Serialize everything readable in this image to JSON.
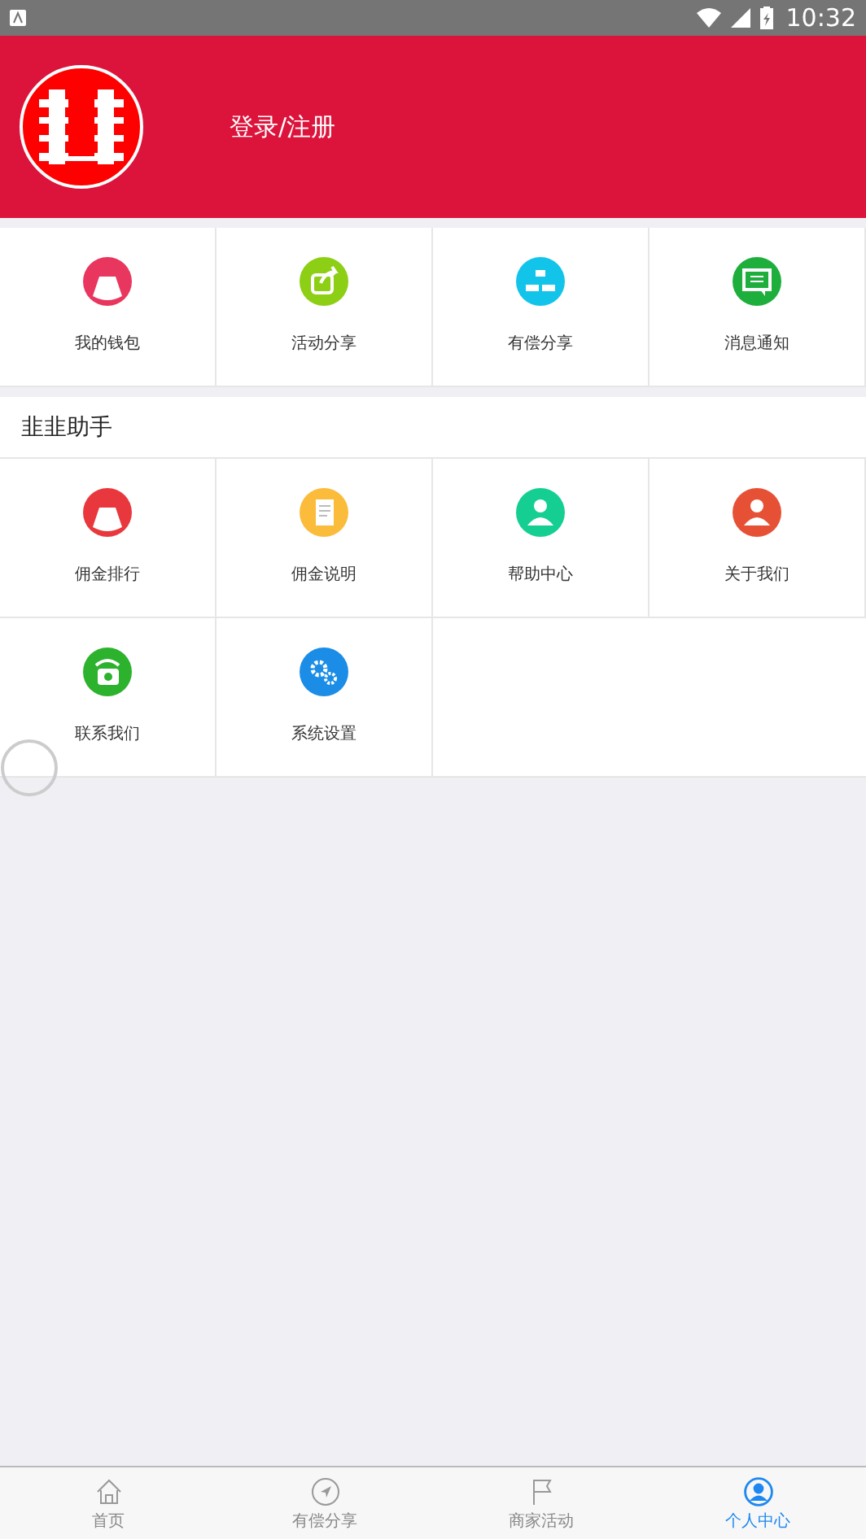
{
  "status_bar": {
    "time": "10:32"
  },
  "header": {
    "login_label": "登录/注册"
  },
  "quick_menu": [
    {
      "label": "我的钱包",
      "kind": "wallet",
      "color": "#e8365f"
    },
    {
      "label": "活动分享",
      "kind": "share",
      "color": "#8ccf14"
    },
    {
      "label": "有偿分享",
      "kind": "network",
      "color": "#12c4ea"
    },
    {
      "label": "消息通知",
      "kind": "message",
      "color": "#1eae3c"
    }
  ],
  "assistant": {
    "title": "韭韭助手",
    "items": [
      {
        "label": "佣金排行",
        "kind": "moneybag",
        "color": "#e8383d"
      },
      {
        "label": "佣金说明",
        "kind": "document",
        "color": "#fbbc3c"
      },
      {
        "label": "帮助中心",
        "kind": "person",
        "color": "#15cf92"
      },
      {
        "label": "关于我们",
        "kind": "group",
        "color": "#e65136"
      },
      {
        "label": "联系我们",
        "kind": "phone",
        "color": "#2db22d"
      },
      {
        "label": "系统设置",
        "kind": "gears",
        "color": "#1b8de6"
      }
    ]
  },
  "tab_bar": [
    {
      "label": "首页",
      "kind": "home",
      "selected": false
    },
    {
      "label": "有偿分享",
      "kind": "compass",
      "selected": false
    },
    {
      "label": "商家活动",
      "kind": "flag",
      "selected": false
    },
    {
      "label": "个人中心",
      "kind": "user",
      "selected": true
    }
  ]
}
